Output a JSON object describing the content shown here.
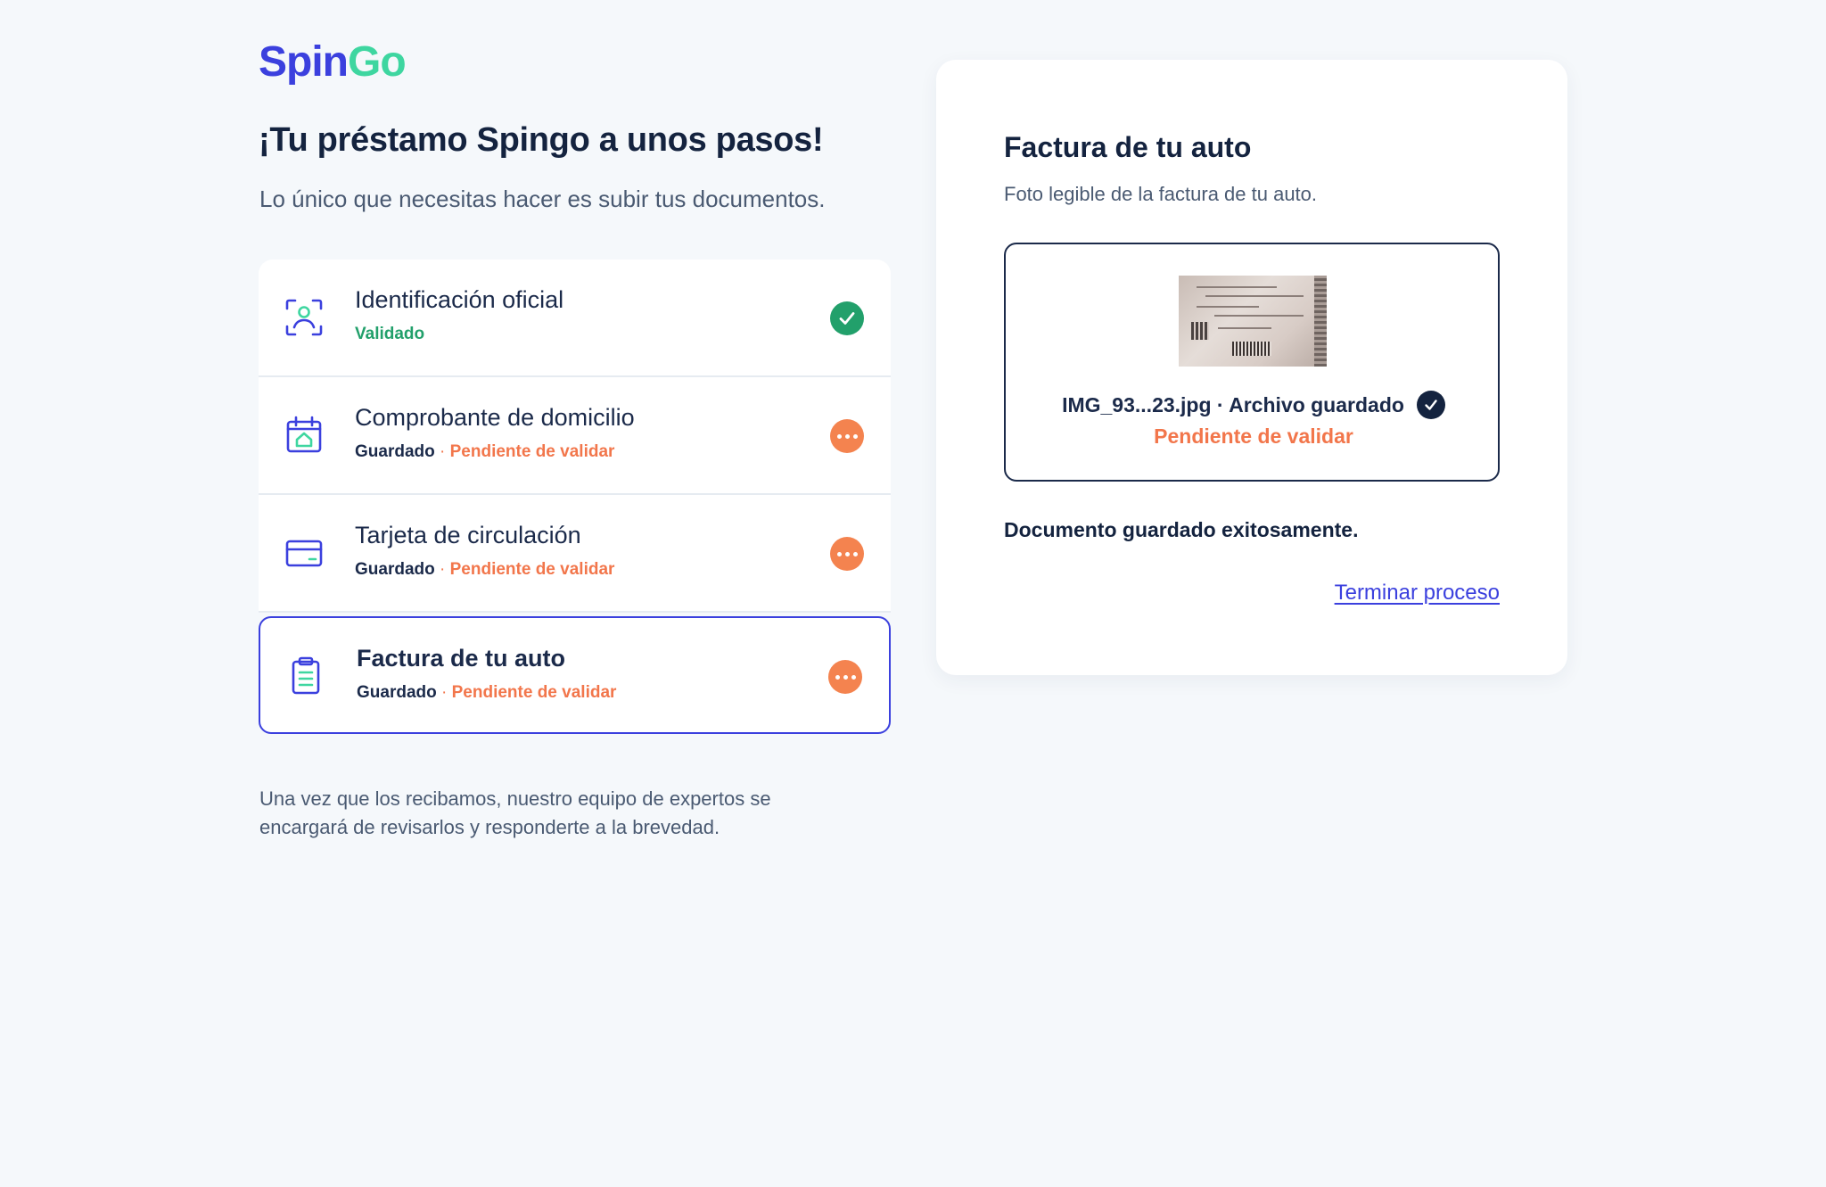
{
  "brand": {
    "spin": "Spin",
    "go": "Go"
  },
  "headline": "¡Tu préstamo Spingo a unos pasos!",
  "subheadline": "Lo único que necesitas hacer es subir tus documentos.",
  "documents": [
    {
      "title": "Identificación oficial",
      "status": "Validado",
      "icon": "id-scan-icon",
      "state": "validated"
    },
    {
      "title": "Comprobante de domicilio",
      "saved": "Guardado",
      "separator": " · ",
      "pending": "Pendiente de validar",
      "icon": "home-calendar-icon",
      "state": "pending"
    },
    {
      "title": "Tarjeta de circulación",
      "saved": "Guardado",
      "separator": " · ",
      "pending": "Pendiente de validar",
      "icon": "card-icon",
      "state": "pending"
    },
    {
      "title": "Factura de tu auto",
      "saved": "Guardado",
      "separator": " · ",
      "pending": "Pendiente de validar",
      "icon": "clipboard-icon",
      "state": "pending",
      "active": true
    }
  ],
  "footnote": "Una vez que los recibamos, nuestro equipo de expertos se encargará de revisarlos y responderte a la brevedad.",
  "panel": {
    "title": "Factura de tu auto",
    "subtitle": "Foto legible de la factura de tu auto.",
    "file_label": "IMG_93...23.jpg · Archivo guardado",
    "file_status": "Pendiente de validar",
    "saved_message": "Documento guardado exitosamente.",
    "finish_link": "Terminar proceso"
  },
  "colors": {
    "primary": "#3b40de",
    "accent": "#3ed6a0",
    "success": "#22a06b",
    "pending": "#f2764b"
  }
}
